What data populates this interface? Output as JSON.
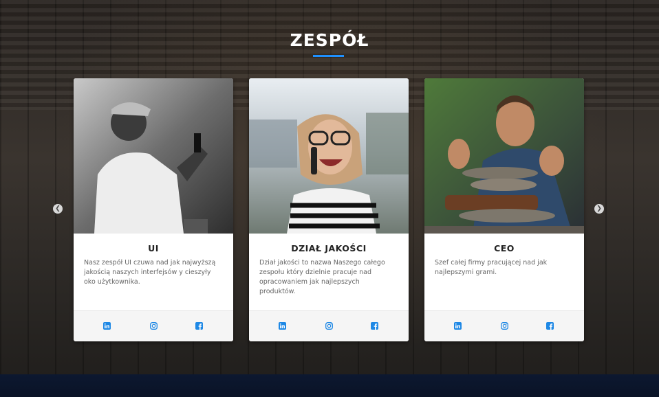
{
  "section": {
    "title": "ZESPÓŁ"
  },
  "carousel": {
    "prev_icon": "chevron-left-icon",
    "next_icon": "chevron-right-icon",
    "prev_glyph": "❮",
    "next_glyph": "❯"
  },
  "cards": [
    {
      "name": "UI",
      "description": "Nasz zespół UI czuwa nad jak najwyższą jakością naszych interfejsów y cieszyły oko użytkownika.",
      "photo": "man-taking-photo-with-phone (black and white)"
    },
    {
      "name": "DZIAŁ JAKOŚCI",
      "description": "Dział jakości to nazwa Naszego całego zespołu który dzielnie pracuje nad opracowaniem jak najlepszych produktów.",
      "photo": "woman-with-glasses-laughing-on-phone"
    },
    {
      "name": "CEO",
      "description": "Szef całej firmy pracującej nad jak najlepszymi grami.",
      "photo": "man-stacking-stones"
    }
  ],
  "social_icons": [
    "linkedin-icon",
    "instagram-icon",
    "facebook-icon"
  ],
  "colors": {
    "accent": "#1e90ff",
    "social": "#1e88e5",
    "card_bg": "#ffffff",
    "footer_bg": "#f5f5f5"
  }
}
